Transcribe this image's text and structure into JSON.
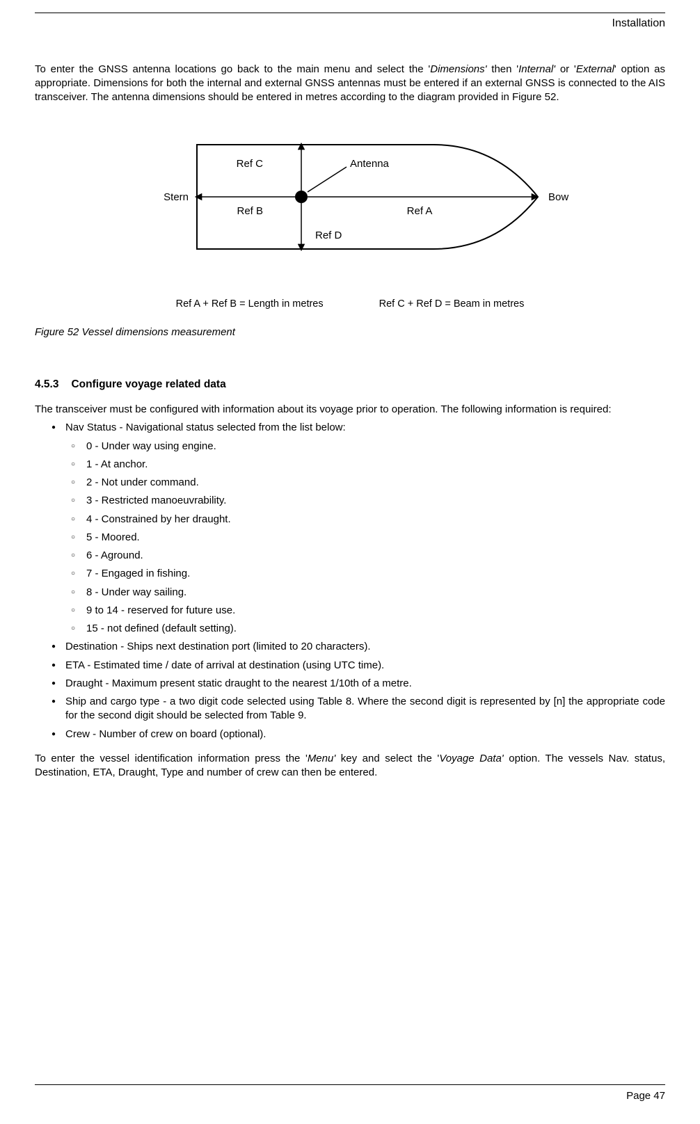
{
  "header": {
    "section": "Installation"
  },
  "intro": {
    "pre1": "To enter the GNSS antenna locations go back to the main menu and select the '",
    "i1": "Dimensions'",
    "mid1": " then '",
    "i2": "Internal'",
    "mid2": " or '",
    "i3": "External",
    "post": "' option as appropriate. Dimensions for both the internal and external GNSS antennas must be entered if an external GNSS is connected to the AIS transceiver. The antenna dimensions should be entered in metres according to the diagram provided in Figure 52."
  },
  "diagram": {
    "stern": "Stern",
    "bow": "Bow",
    "antenna": "Antenna",
    "refA": "Ref A",
    "refB": "Ref B",
    "refC": "Ref C",
    "refD": "Ref D",
    "formulaL": "Ref A + Ref B = Length in metres",
    "formulaR": "Ref C + Ref D = Beam in metres"
  },
  "figure_caption": "Figure 52    Vessel dimensions measurement",
  "section": {
    "number": "4.5.3",
    "title": "Configure voyage related data"
  },
  "section_intro": "The transceiver must be configured with information about its voyage prior to operation. The following information is required:",
  "nav_status_intro": "Nav Status - Navigational status selected from the list below:",
  "nav_status_items": [
    "0 - Under way using engine.",
    "1 - At anchor.",
    "2 - Not under command.",
    "3 - Restricted manoeuvrability.",
    "4 - Constrained by her draught.",
    "5 - Moored.",
    "6 - Aground.",
    "7 - Engaged in fishing.",
    "8 - Under way sailing.",
    "9 to 14 - reserved for future use.",
    "15 - not defined (default setting)."
  ],
  "other_bullets": [
    "Destination - Ships next destination port (limited to 20 characters).",
    "ETA - Estimated time / date of arrival at destination (using UTC time).",
    "Draught - Maximum present static draught to the nearest 1/10th of a metre.",
    "Ship and cargo type - a two digit code selected using Table 8. Where the second digit is represented by [n] the appropriate code for the second digit should be selected from Table 9.",
    "Crew - Number of crew on board (optional)."
  ],
  "closing": {
    "pre": "To enter the vessel identification information press the '",
    "i1": "Menu'",
    "mid": " key and select the '",
    "i2": "Voyage Data'",
    "post": " option. The vessels Nav. status, Destination, ETA, Draught, Type and number of crew can then be entered."
  },
  "footer": {
    "page": "Page 47"
  }
}
